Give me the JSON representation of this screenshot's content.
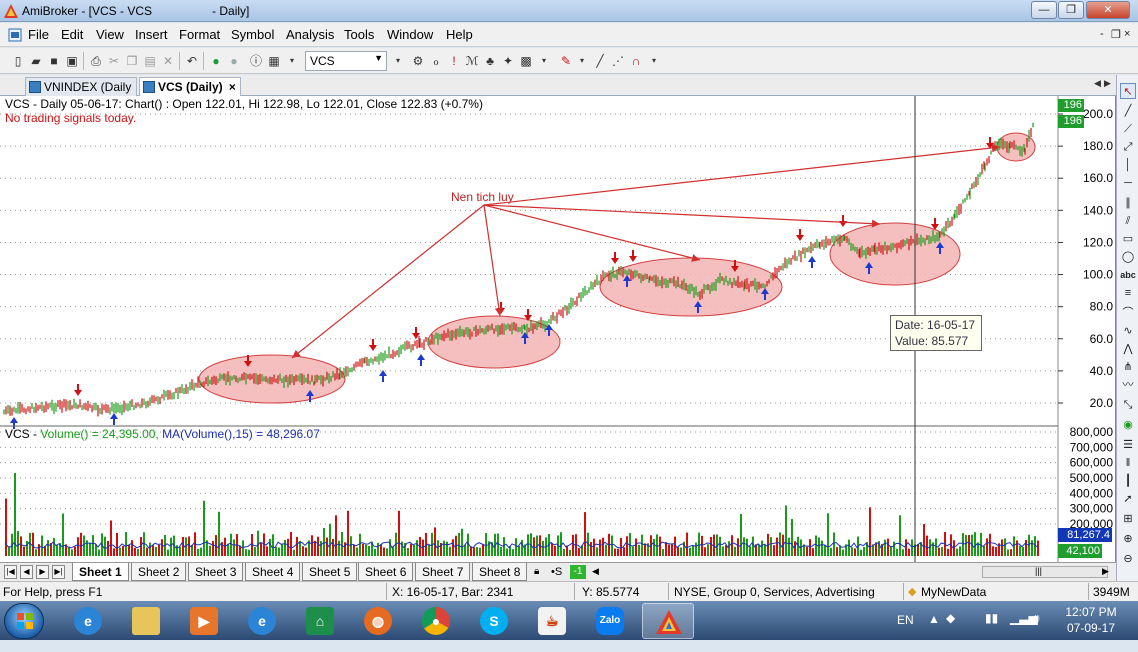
{
  "window": {
    "title": "AmiBroker - [VCS - VCS                  - Daily]",
    "minimize": "—",
    "maximize": "❐",
    "close": "✕"
  },
  "menu": {
    "items": [
      "File",
      "Edit",
      "View",
      "Insert",
      "Format",
      "Symbol",
      "Analysis",
      "Tools",
      "Window",
      "Help"
    ],
    "mdi_min": "-",
    "mdi_restore": "❐",
    "mdi_close": "×"
  },
  "toolbar": {
    "symbol_value": "VCS"
  },
  "tabs": [
    {
      "label": "VNINDEX (Daily",
      "active": false
    },
    {
      "label": "VCS (Daily)",
      "active": true
    }
  ],
  "price_pane": {
    "header": "VCS - Daily 05-06-17: Chart() : Open 122.01, Hi 122.98, Lo 122.01, Close 122.83 (+0.7%)",
    "signal_text": "No trading signals today.",
    "y_ticks": [
      "200.0",
      "180.0",
      "160.0",
      "140.0",
      "120.0",
      "100.0",
      "80.0",
      "60.0",
      "40.0",
      "20.0"
    ],
    "last_value_top": "196",
    "last_value_bottom": "196",
    "annotation": "Nen tich luy",
    "tooltip_date": "Date: 16-05-17",
    "tooltip_value": "Value: 85.577"
  },
  "volume_pane": {
    "header_prefix": "VCS - ",
    "header_volume": "Volume() = 24,395.00,",
    "header_ma": "MA(Volume(),15) = 48,296.07",
    "y_ticks": [
      "800,000",
      "700,000",
      "600,000",
      "500,000",
      "400,000",
      "300,000",
      "200,000"
    ],
    "ma_label": "81,267.4",
    "vol_label": "42,100"
  },
  "colors": {
    "up": "#1a9b1a",
    "down": "#d01010",
    "ellipse_fill": "#f4b4b4",
    "ellipse_stroke": "#d04040",
    "ma_line": "#1c2fb4",
    "label_green": "#1f9e2e",
    "label_blue": "#1238b8"
  },
  "sheets": [
    "Sheet 1",
    "Sheet 2",
    "Sheet 3",
    "Sheet 4",
    "Sheet 5",
    "Sheet 6",
    "Sheet 7",
    "Sheet 8"
  ],
  "sheet_extra": [
    "•S",
    "-1"
  ],
  "status": {
    "help": "For Help, press F1",
    "xinfo": "X: 16-05-17, Bar: 2341",
    "yinfo": "Y: 85.5774",
    "exchange": "NYSE, Group 0, Services, Advertising",
    "database": "MyNewData",
    "memory": "3949M"
  },
  "taskbar": {
    "lang": "EN",
    "time": "12:07 PM",
    "date": "07-09-17",
    "apps": [
      "ie-icon",
      "folder-icon",
      "media-player-icon",
      "ie2-icon",
      "vietcombank-icon",
      "firefox-icon",
      "chrome-icon",
      "skype-icon",
      "java-icon",
      "zalo-icon",
      "amibroker-icon"
    ]
  }
}
